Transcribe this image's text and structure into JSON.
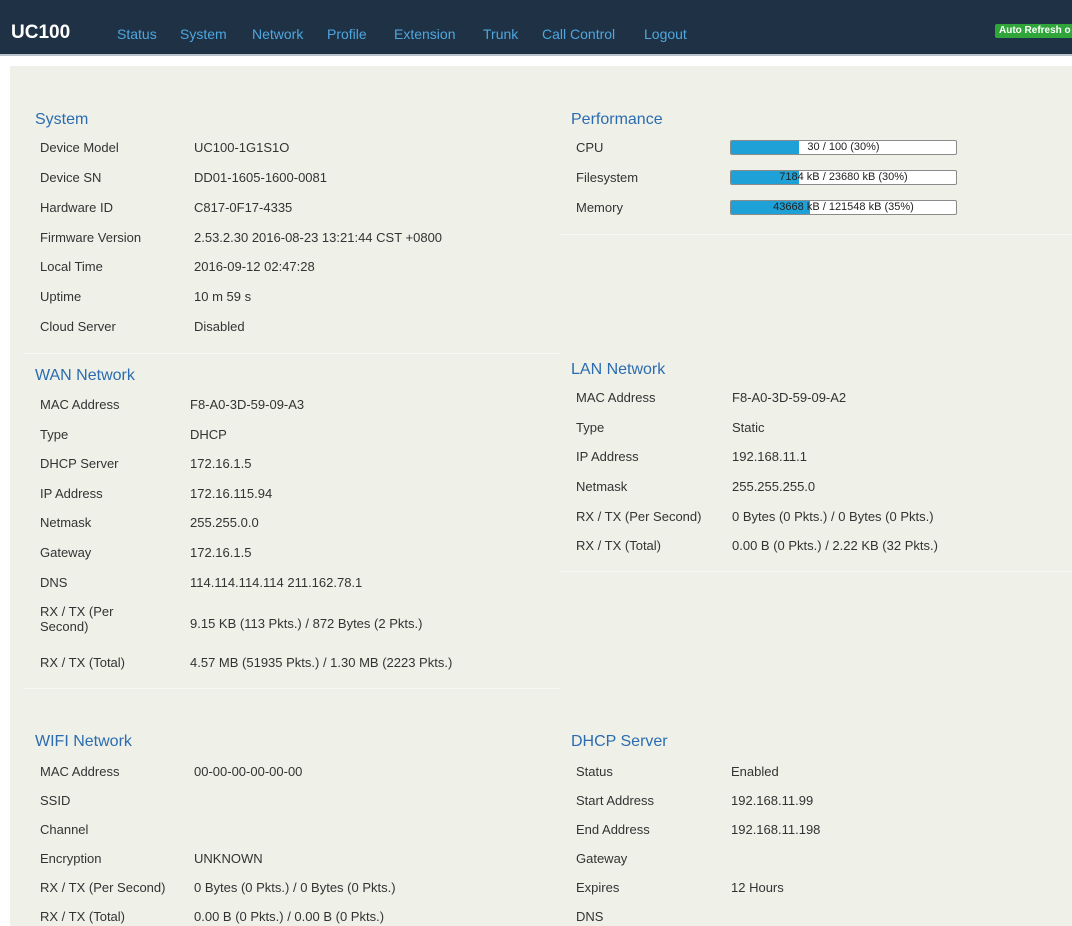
{
  "navbar": {
    "brand": "UC100",
    "items": [
      "Status",
      "System",
      "Network",
      "Profile",
      "Extension",
      "Trunk",
      "Call Control",
      "Logout"
    ],
    "auto_refresh": "Auto Refresh o"
  },
  "system": {
    "title": "System",
    "rows": [
      {
        "label": "Device Model",
        "value": "UC100-1G1S1O"
      },
      {
        "label": "Device SN",
        "value": "DD01-1605-1600-0081"
      },
      {
        "label": "Hardware ID",
        "value": "C817-0F17-4335"
      },
      {
        "label": "Firmware Version",
        "value": "2.53.2.30 2016-08-23 13:21:44 CST +0800"
      },
      {
        "label": "Local Time",
        "value": "2016-09-12 02:47:28"
      },
      {
        "label": "Uptime",
        "value": "10 m 59 s"
      },
      {
        "label": "Cloud Server",
        "value": "Disabled"
      }
    ]
  },
  "performance": {
    "title": "Performance",
    "rows": [
      {
        "label": "CPU",
        "text": "30 / 100 (30%)",
        "fraction": 0.3
      },
      {
        "label": "Filesystem",
        "text": "7184 kB / 23680 kB (30%)",
        "fraction": 0.3
      },
      {
        "label": "Memory",
        "text": "43668 kB / 121548 kB (35%)",
        "fraction": 0.35
      }
    ]
  },
  "wan": {
    "title": "WAN Network",
    "rows": [
      {
        "label": "MAC Address",
        "value": "F8-A0-3D-59-09-A3"
      },
      {
        "label": "Type",
        "value": "DHCP"
      },
      {
        "label": "DHCP Server",
        "value": "172.16.1.5"
      },
      {
        "label": "IP Address",
        "value": "172.16.115.94"
      },
      {
        "label": "Netmask",
        "value": "255.255.0.0"
      },
      {
        "label": "Gateway",
        "value": "172.16.1.5"
      },
      {
        "label": "DNS",
        "value": "114.114.114.114 211.162.78.1"
      },
      {
        "label": "RX / TX (Per Second)",
        "value": "9.15 KB (113 Pkts.) / 872 Bytes (2 Pkts.)"
      },
      {
        "label": "RX / TX (Total)",
        "value": "4.57 MB (51935 Pkts.) / 1.30 MB (2223 Pkts.)"
      }
    ]
  },
  "lan": {
    "title": "LAN Network",
    "rows": [
      {
        "label": "MAC Address",
        "value": "F8-A0-3D-59-09-A2"
      },
      {
        "label": "Type",
        "value": "Static"
      },
      {
        "label": "IP Address",
        "value": "192.168.11.1"
      },
      {
        "label": "Netmask",
        "value": "255.255.255.0"
      },
      {
        "label": "RX / TX (Per Second)",
        "value": "0 Bytes (0 Pkts.) / 0 Bytes (0 Pkts.)"
      },
      {
        "label": "RX / TX (Total)",
        "value": "0.00 B (0 Pkts.) / 2.22 KB (32 Pkts.)"
      }
    ]
  },
  "wifi": {
    "title": "WIFI Network",
    "rows": [
      {
        "label": "MAC Address",
        "value": "00-00-00-00-00-00"
      },
      {
        "label": "SSID",
        "value": ""
      },
      {
        "label": "Channel",
        "value": ""
      },
      {
        "label": "Encryption",
        "value": "UNKNOWN"
      },
      {
        "label": "RX / TX (Per Second)",
        "value": "0 Bytes (0 Pkts.) / 0 Bytes (0 Pkts.)"
      },
      {
        "label": "RX / TX (Total)",
        "value": "0.00 B (0 Pkts.) / 0.00 B (0 Pkts.)"
      }
    ]
  },
  "dhcp": {
    "title": "DHCP Server",
    "rows": [
      {
        "label": "Status",
        "value": "Enabled"
      },
      {
        "label": "Start Address",
        "value": "192.168.11.99"
      },
      {
        "label": "End Address",
        "value": "192.168.11.198"
      },
      {
        "label": "Gateway",
        "value": ""
      },
      {
        "label": "Expires",
        "value": "12 Hours"
      },
      {
        "label": "DNS",
        "value": ""
      }
    ]
  }
}
